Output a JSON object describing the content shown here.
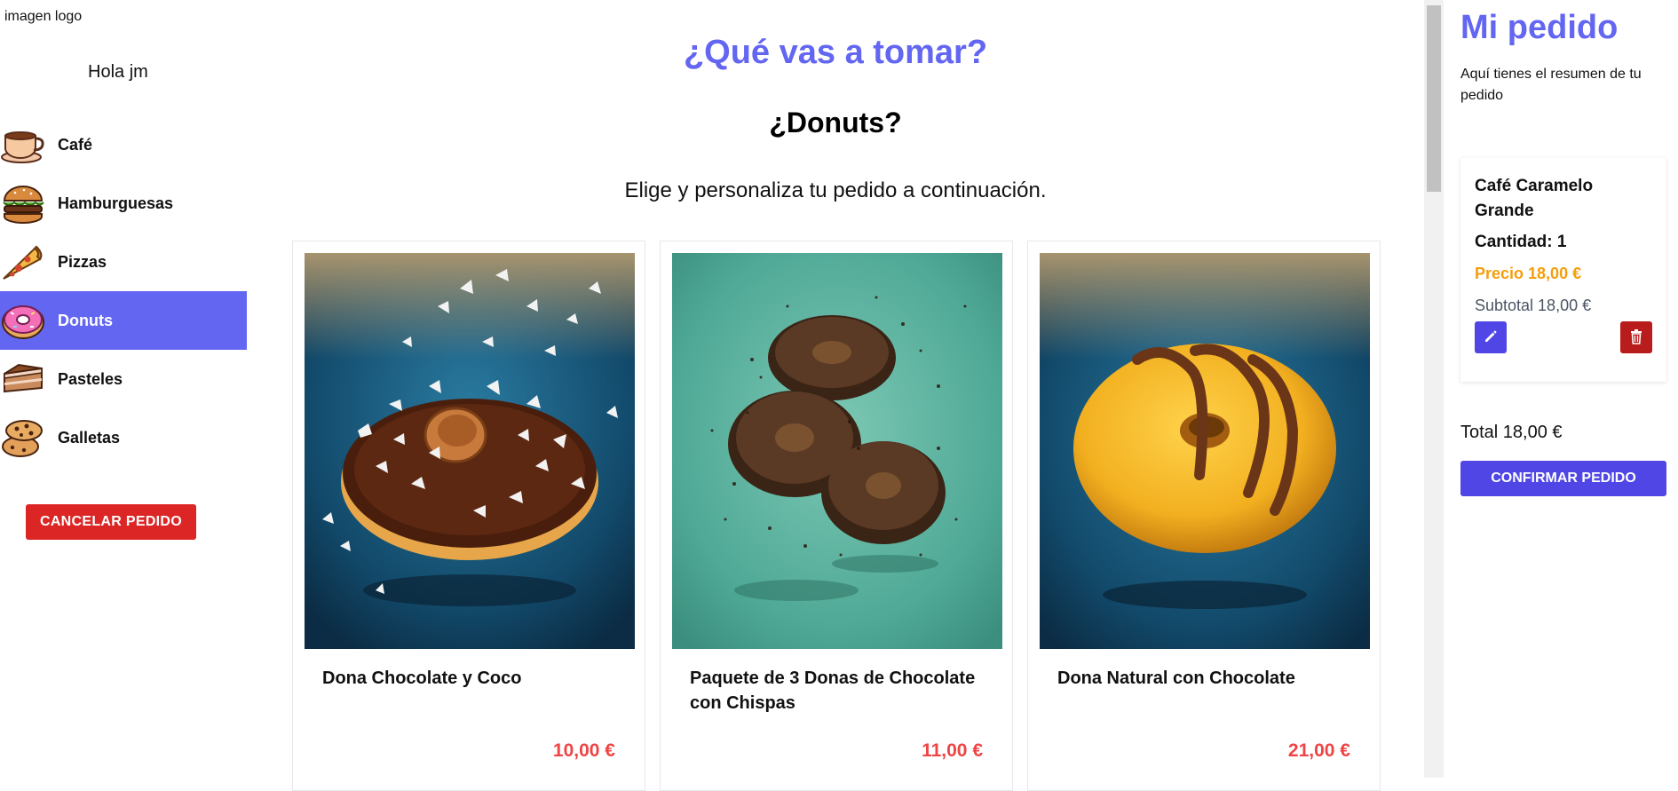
{
  "sidebar": {
    "logo_text": "imagen logo",
    "greeting": "Hola jm",
    "categories": [
      {
        "label": "Café",
        "icon": "coffee-icon",
        "active": false
      },
      {
        "label": "Hamburguesas",
        "icon": "burger-icon",
        "active": false
      },
      {
        "label": "Pizzas",
        "icon": "pizza-icon",
        "active": false
      },
      {
        "label": "Donuts",
        "icon": "donut-icon",
        "active": true
      },
      {
        "label": "Pasteles",
        "icon": "cake-icon",
        "active": false
      },
      {
        "label": "Galletas",
        "icon": "cookie-icon",
        "active": false
      }
    ],
    "cancel_label": "CANCELAR PEDIDO"
  },
  "main": {
    "title": "¿Qué vas a tomar?",
    "subtitle": "¿Donuts?",
    "description": "Elige y personaliza tu pedido a continuación.",
    "products": [
      {
        "name": "Dona Chocolate y Coco",
        "price": "10,00 €"
      },
      {
        "name": "Paquete de 3 Donas de Chocolate con Chispas",
        "price": "11,00 €"
      },
      {
        "name": "Dona Natural con Chocolate",
        "price": "21,00 €"
      }
    ]
  },
  "order": {
    "title": "Mi pedido",
    "description": "Aquí tienes el resumen de tu pedido",
    "items": [
      {
        "name": "Café Caramelo Grande",
        "quantity": "Cantidad: 1",
        "price": "Precio 18,00 €",
        "subtotal": "Subtotal 18,00 €"
      }
    ],
    "total": "Total 18,00 €",
    "confirm_label": "CONFIRMAR PEDIDO"
  },
  "colors": {
    "accent": "#6366f1",
    "danger": "#dc2626",
    "price": "#ef4444",
    "warning": "#f59e0b"
  }
}
